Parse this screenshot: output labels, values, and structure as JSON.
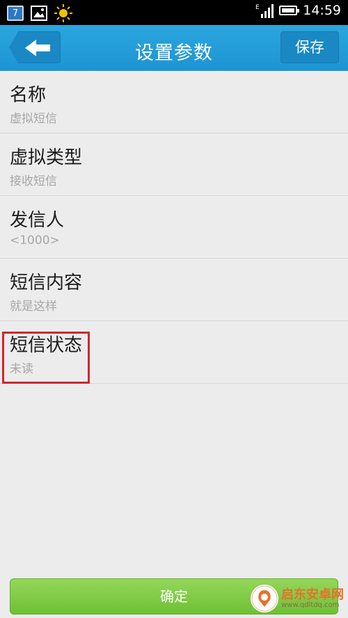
{
  "status_bar": {
    "calendar_day": "7",
    "network_type": "E",
    "time": "14:59",
    "icons": [
      "calendar-icon",
      "gallery-icon",
      "brightness-icon",
      "signal-icon",
      "battery-icon"
    ]
  },
  "header": {
    "title": "设置参数",
    "save_label": "保存",
    "back_icon": "back-arrow-icon"
  },
  "settings": [
    {
      "label": "名称",
      "value": "虚拟短信"
    },
    {
      "label": "虚拟类型",
      "value": "接收短信"
    },
    {
      "label": "发信人",
      "value": "<1000>"
    },
    {
      "label": "短信内容",
      "value": "就是这样"
    },
    {
      "label": "短信状态",
      "value": "未读"
    }
  ],
  "confirm_label": "确定",
  "watermark": {
    "title": "启东安卓网",
    "url": "www.qdltdq.com"
  },
  "colors": {
    "header": "#1d94d3",
    "confirm": "#76c43d",
    "highlight": "#d0262f"
  }
}
